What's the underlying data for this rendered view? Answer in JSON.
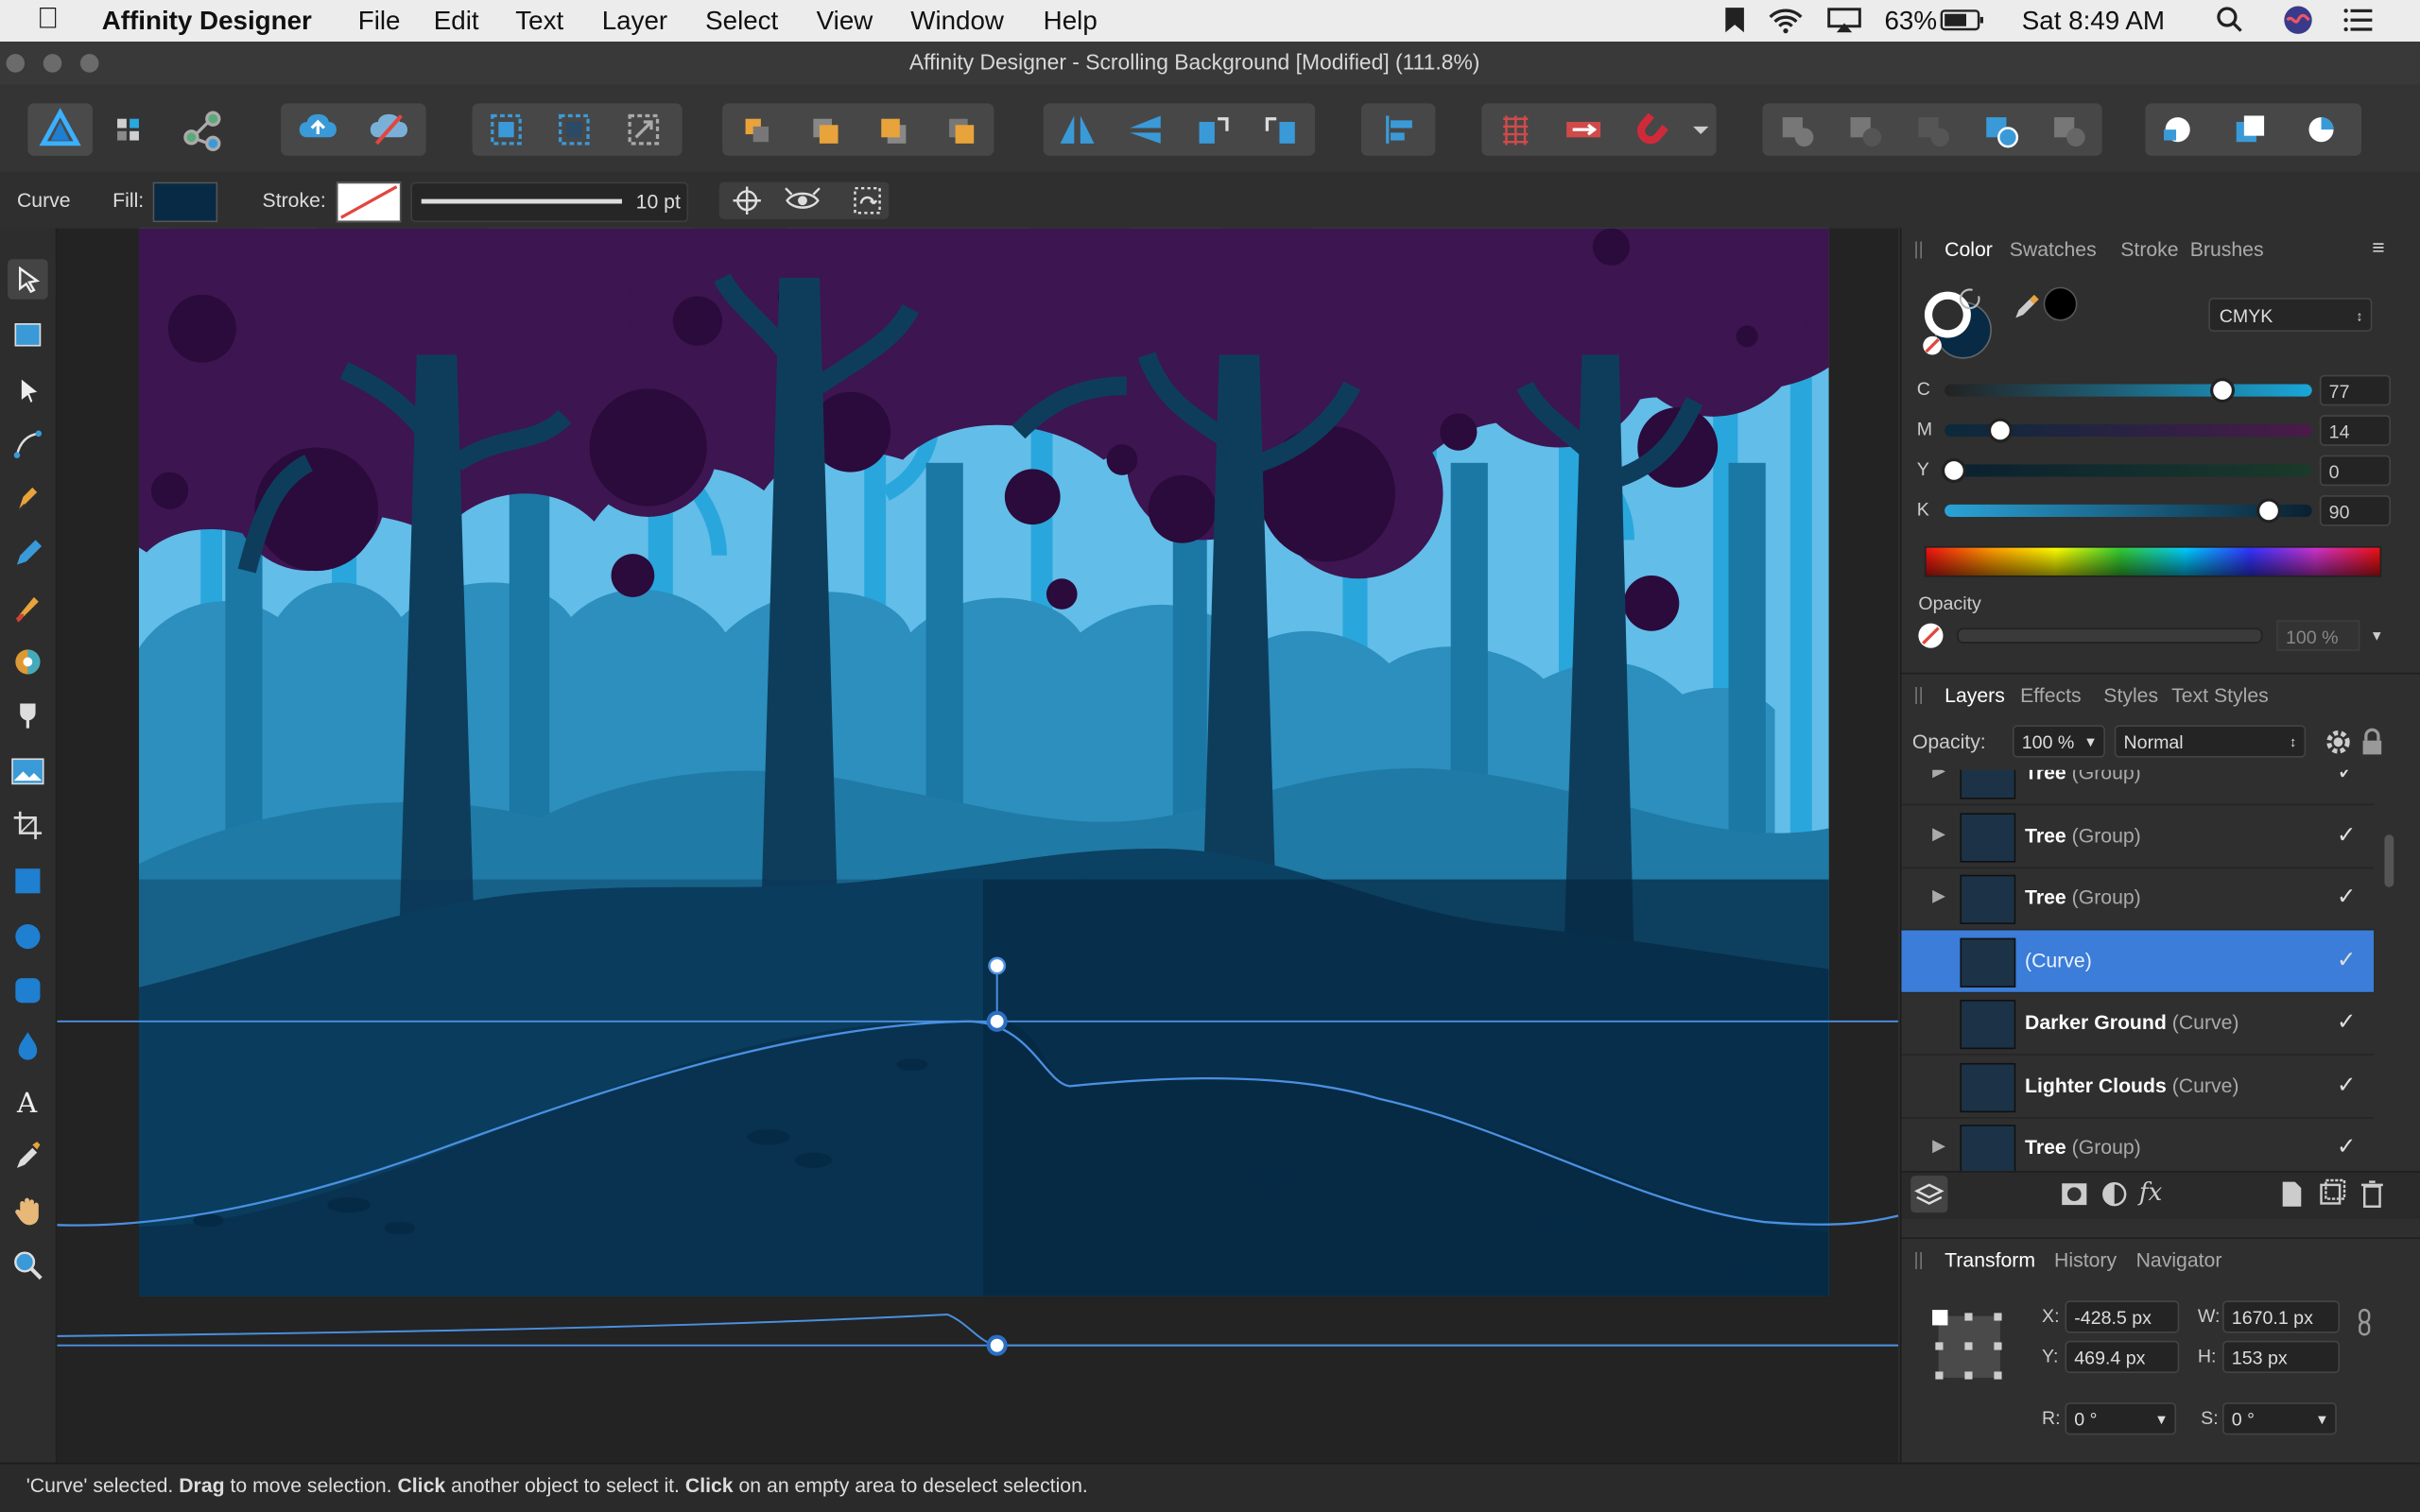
{
  "menubar": {
    "app_name": "Affinity Designer",
    "items": [
      "File",
      "Edit",
      "Text",
      "Layer",
      "Select",
      "View",
      "Window",
      "Help"
    ],
    "battery": "63%",
    "clock": "Sat 8:49 AM"
  },
  "window": {
    "title": "Affinity Designer - Scrolling Background [Modified] (111.8%)"
  },
  "context_bar": {
    "tool_name": "Curve",
    "fill_label": "Fill:",
    "stroke_label": "Stroke:",
    "stroke_width": "10 pt"
  },
  "color_panel": {
    "tabs": [
      "Color",
      "Swatches",
      "Stroke",
      "Brushes"
    ],
    "mode": "CMYK",
    "channels": [
      {
        "label": "C",
        "value": "77",
        "color": "#27b6e6"
      },
      {
        "label": "M",
        "value": "14",
        "color": "#d6128a"
      },
      {
        "label": "Y",
        "value": "0",
        "color": "#f2e31b"
      },
      {
        "label": "K",
        "value": "90",
        "color": "#3a3a3a"
      }
    ],
    "opacity_label": "Opacity",
    "opacity_value": "100 %"
  },
  "layers_panel": {
    "tabs": [
      "Layers",
      "Effects",
      "Styles",
      "Text Styles"
    ],
    "opacity_label": "Opacity:",
    "opacity_value": "100 %",
    "blend_mode": "Normal",
    "rows": [
      {
        "name": "Tree",
        "type": "(Group)",
        "expandable": true,
        "selected": false
      },
      {
        "name": "Tree",
        "type": "(Group)",
        "expandable": true,
        "selected": false
      },
      {
        "name": "Tree",
        "type": "(Group)",
        "expandable": true,
        "selected": false
      },
      {
        "name": "",
        "type": "(Curve)",
        "expandable": false,
        "selected": true
      },
      {
        "name": "Darker Ground",
        "type": "(Curve)",
        "expandable": false,
        "selected": false
      },
      {
        "name": "Lighter Clouds",
        "type": "(Curve)",
        "expandable": false,
        "selected": false
      },
      {
        "name": "Tree",
        "type": "(Group)",
        "expandable": true,
        "selected": false
      }
    ]
  },
  "transform_panel": {
    "tabs": [
      "Transform",
      "History",
      "Navigator"
    ],
    "x_label": "X:",
    "x": "-428.5 px",
    "y_label": "Y:",
    "y": "469.4 px",
    "w_label": "W:",
    "w": "1670.1 px",
    "h_label": "H:",
    "h": "153 px",
    "r_label": "R:",
    "r": "0 °",
    "s_label": "S:",
    "s": "0 °"
  },
  "status": {
    "parts": [
      "'Curve' selected. ",
      "Drag",
      " to move selection. ",
      "Click",
      " another object to select it. ",
      "Click",
      " on an empty area to deselect selection."
    ]
  },
  "colors": {
    "accent": "#3b7dd8",
    "selection_line": "#4a90e2",
    "sky": "#62bde8",
    "canopy": "#3d1550",
    "ground": "#0b3a5c"
  }
}
